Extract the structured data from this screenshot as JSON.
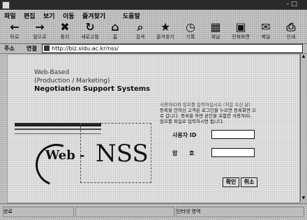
{
  "window": {
    "title": ""
  },
  "titlebar": {
    "controls": "– □"
  },
  "menu": {
    "items": [
      "파일",
      "편집",
      "보기",
      "이동",
      "즐겨찾기",
      "도움말"
    ]
  },
  "toolbar": {
    "buttons": [
      {
        "icon": "back-icon",
        "glyph": "←",
        "label": "뒤로"
      },
      {
        "icon": "forward-icon",
        "glyph": "→",
        "label": "앞으로"
      },
      {
        "icon": "stop-icon",
        "glyph": "✖",
        "label": "중지"
      },
      {
        "icon": "refresh-icon",
        "glyph": "↻",
        "label": "새로고침"
      },
      {
        "icon": "home-icon",
        "glyph": "⌂",
        "label": "홈"
      },
      {
        "icon": "search-icon",
        "glyph": "⌕",
        "label": "검색"
      },
      {
        "icon": "favorites-icon",
        "glyph": "★",
        "label": "즐겨찾기"
      },
      {
        "icon": "history-icon",
        "glyph": "◷",
        "label": "기록"
      },
      {
        "icon": "channels-icon",
        "glyph": "▦",
        "label": "채널"
      },
      {
        "icon": "fullscreen-icon",
        "glyph": "▣",
        "label": "전체화면"
      },
      {
        "icon": "mail-icon",
        "glyph": "✉",
        "label": "메일"
      },
      {
        "icon": "print-icon",
        "glyph": "⎙",
        "label": "인쇄"
      }
    ]
  },
  "address": {
    "label": "주소",
    "links_label": "연결",
    "url": "http://biz.sldu.ac.kr/nss/"
  },
  "page": {
    "line1": "Web-Based",
    "line2": "(Production / Marketing)",
    "line3": "Negotiation Support Systems",
    "logo_web": "Web -",
    "logo_nss": "NSS",
    "desc": [
      "사용자ID와 암호를 입력하십시오 (처음 오신 분)",
      "등록을 안하신 고객은 로그인을 누르면 등록화면 으",
      "로 갑니다. 등록을 하면 본인을 포함한 사용자ID,",
      "암호를 파일로 입력하시면 됩니다."
    ],
    "user_label": "사용자 ID",
    "password_label": "암      호",
    "user_value": "",
    "password_value": "",
    "confirm_button": "확인",
    "cancel_button": "취소"
  },
  "status": {
    "left": "완료",
    "middle": "",
    "right": "인터넷 영역"
  }
}
